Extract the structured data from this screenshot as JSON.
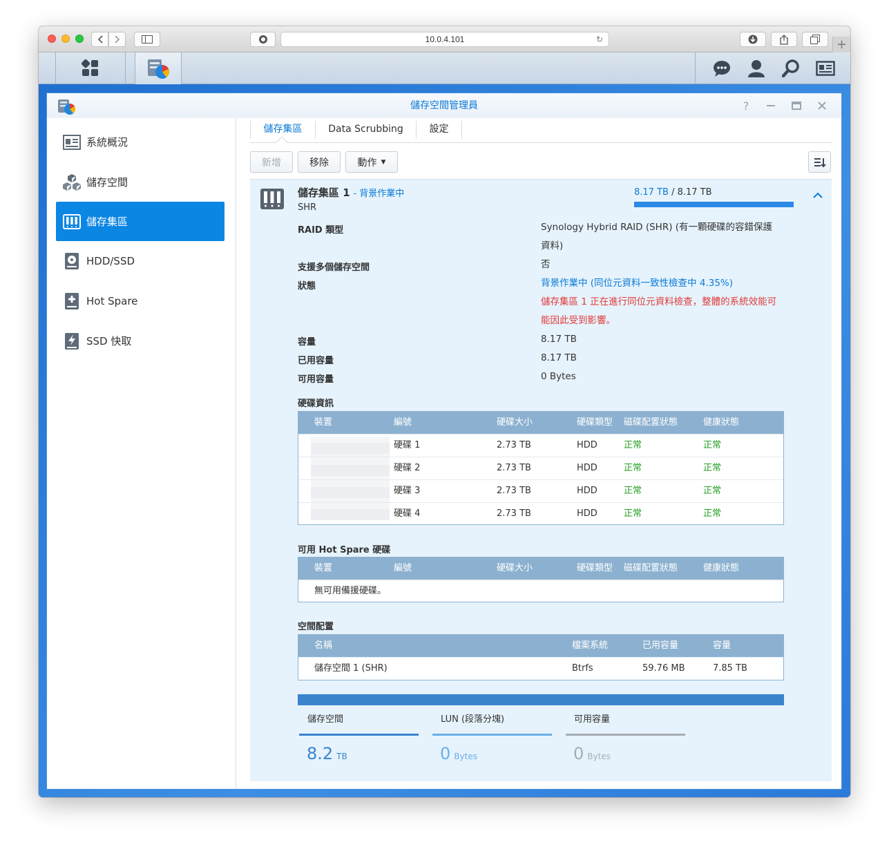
{
  "browser": {
    "url": "10.0.4.101"
  },
  "app": {
    "title": "儲存空間管理員"
  },
  "sidebar": {
    "items": [
      {
        "label": "系統概況",
        "icon": "overview-icon"
      },
      {
        "label": "儲存空間",
        "icon": "volume-icon"
      },
      {
        "label": "儲存集區",
        "icon": "storage-pool-icon",
        "active": true
      },
      {
        "label": "HDD/SSD",
        "icon": "hdd-icon"
      },
      {
        "label": "Hot Spare",
        "icon": "hot-spare-icon"
      },
      {
        "label": "SSD 快取",
        "icon": "ssd-cache-icon"
      }
    ]
  },
  "tabs": [
    "儲存集區",
    "Data Scrubbing",
    "設定"
  ],
  "toolbar": {
    "create": "新增",
    "remove": "移除",
    "action": "動作"
  },
  "pool": {
    "name": "儲存集區 1",
    "status_tag": "- 背景作業中",
    "type": "SHR",
    "used": "8.17 TB",
    "total": "/ 8.17 TB",
    "usage_fraction": 1.0,
    "props": {
      "raid_label": "RAID 類型",
      "raid_value": "Synology Hybrid RAID (SHR) (有一顆硬碟的容錯保護資料)",
      "multi_label": "支援多個儲存空間",
      "multi_value": "否",
      "status_label": "狀態",
      "status_value": "背景作業中 (同位元資料一致性檢查中 4.35%)",
      "status_warning": "儲存集區 1 正在進行同位元資料檢查，整體的系統效能可能因此受到影響。",
      "capacity_label": "容量",
      "capacity_value": "8.17 TB",
      "used_label": "已用容量",
      "used_value": "8.17 TB",
      "free_label": "可用容量",
      "free_value": "0 Bytes"
    }
  },
  "disk_info": {
    "title": "硬碟資訊",
    "headers": [
      "裝置",
      "編號",
      "硬碟大小",
      "硬碟類型",
      "磁碟配置狀態",
      "健康狀態"
    ],
    "rows": [
      {
        "id": "硬碟 1",
        "size": "2.73 TB",
        "type": "HDD",
        "alloc": "正常",
        "health": "正常"
      },
      {
        "id": "硬碟 2",
        "size": "2.73 TB",
        "type": "HDD",
        "alloc": "正常",
        "health": "正常"
      },
      {
        "id": "硬碟 3",
        "size": "2.73 TB",
        "type": "HDD",
        "alloc": "正常",
        "health": "正常"
      },
      {
        "id": "硬碟 4",
        "size": "2.73 TB",
        "type": "HDD",
        "alloc": "正常",
        "health": "正常"
      }
    ]
  },
  "hot_spare": {
    "title": "可用 Hot Spare 硬碟",
    "headers": [
      "裝置",
      "編號",
      "硬碟大小",
      "硬碟類型",
      "磁碟配置狀態",
      "健康狀態"
    ],
    "empty": "無可用備援硬碟。"
  },
  "allocation": {
    "title": "空間配置",
    "headers": [
      "名稱",
      "檔案系統",
      "已用容量",
      "容量"
    ],
    "rows": [
      {
        "name": "儲存空間 1 (SHR)",
        "fs": "Btrfs",
        "used": "59.76 MB",
        "capacity": "7.85 TB"
      }
    ]
  },
  "summary": [
    {
      "label": "儲存空間",
      "value": "8.2",
      "unit": "TB",
      "color": "#3a84cc"
    },
    {
      "label": "LUN (段落分塊)",
      "value": "0",
      "unit": "Bytes",
      "color": "#6aaee8"
    },
    {
      "label": "可用容量",
      "value": "0",
      "unit": "Bytes",
      "color": "#a7adb3"
    }
  ]
}
